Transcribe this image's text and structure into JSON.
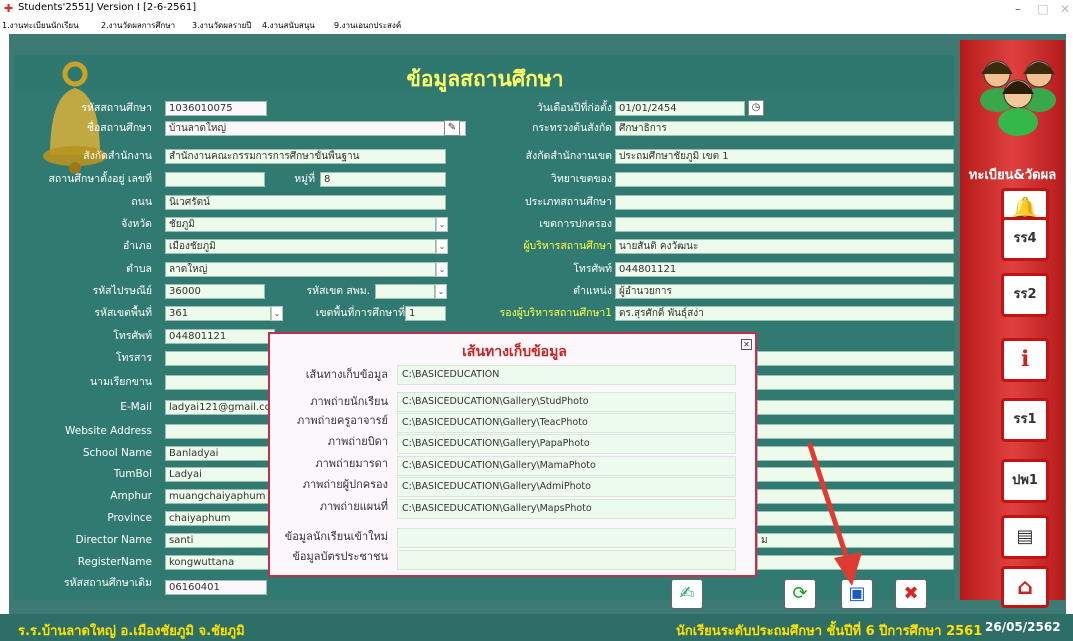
{
  "window": {
    "title": "Students'2551J Version I [2-6-2561]",
    "min": "–",
    "max": "□",
    "close": "✕"
  },
  "menu": [
    "1.งานทะเบียนนักเรียน",
    "2.งานวัดผลการศึกษา",
    "3.งานวัดผลรายปี",
    "4.งานสนับสนุน",
    "9.งานเอนกประสงค์"
  ],
  "page": {
    "title": "ข้อมูลสถานศึกษา"
  },
  "left": {
    "school_code": {
      "label": "รหัสสถานศึกษา",
      "value": "1036010075"
    },
    "school_name": {
      "label": "ชื่อสถานศึกษา",
      "value": "บ้านลาดใหญ่"
    },
    "agency": {
      "label": "สังกัดสำนักงาน",
      "value": "สำนักงานคณะกรรมการการศึกษาขั้นพื้นฐาน"
    },
    "address_no": {
      "label": "สถานศึกษาตั้งอยู่ เลขที่",
      "value": ""
    },
    "moo": {
      "label": "หมู่ที่",
      "value": "8"
    },
    "road": {
      "label": "ถนน",
      "value": "นิเวศรัตน์"
    },
    "province": {
      "label": "จังหวัด",
      "value": "ชัยภูมิ"
    },
    "district": {
      "label": "อำเภอ",
      "value": "เมืองชัยภูมิ"
    },
    "subdistrict": {
      "label": "ตำบล",
      "value": "ลาดใหญ่"
    },
    "postcode": {
      "label": "รหัสไปรษณีย์",
      "value": "36000"
    },
    "spm_code": {
      "label": "รหัสเขต สพม.",
      "value": ""
    },
    "area_code": {
      "label": "รหัสเขตพื้นที่",
      "value": "361"
    },
    "area_no": {
      "label": "เขตพื้นที่การศึกษาที่",
      "value": "1"
    },
    "phone": {
      "label": "โทรศัพท์",
      "value": "044801121"
    },
    "fax": {
      "label": "โทรสาร",
      "value": ""
    },
    "nickname": {
      "label": "นามเรียกขาน",
      "value": ""
    },
    "email": {
      "label": "E-Mail",
      "value": "ladyai121@gmail.com"
    },
    "website": {
      "label": "Website Address",
      "value": ""
    },
    "school_name_en": {
      "label": "School Name",
      "value": "Banladyai"
    },
    "tumbol": {
      "label": "TumBol",
      "value": "Ladyai"
    },
    "amphur": {
      "label": "Amphur",
      "value": "muangchaiyaphum"
    },
    "province_en": {
      "label": "Province",
      "value": "chaiyaphum"
    },
    "director_name": {
      "label": "Director Name",
      "value": "santi"
    },
    "register_name": {
      "label": "RegisterName",
      "value": "kongwuttana"
    },
    "old_code": {
      "label": "รหัสสถานศึกษาเดิม",
      "value": "06160401"
    }
  },
  "right": {
    "founded": {
      "label": "วันเดือนปีที่ก่อตั้ง",
      "value": "01/01/2454"
    },
    "ministry": {
      "label": "กระทรวงต้นสังกัด",
      "value": "ศึกษาธิการ"
    },
    "area_office": {
      "label": "สังกัดสำนักงานเขต",
      "value": "ประถมศึกษาชัยภูมิ เขต 1"
    },
    "college_zone": {
      "label": "วิทยาเขตของ",
      "value": ""
    },
    "school_type": {
      "label": "ประเภทสถานศึกษา",
      "value": ""
    },
    "admin_zone": {
      "label": "เขตการปกครอง",
      "value": ""
    },
    "director": {
      "label": "ผู้บริหารสถานศึกษา",
      "value": "นายสันติ คงวัฒนะ"
    },
    "phone": {
      "label": "โทรศัพท์",
      "value": "044801121"
    },
    "position": {
      "label": "ตำแหน่ง",
      "value": "ผู้อำนวยการ"
    },
    "deputy": {
      "label": "รองผู้บริหารสถานศึกษา1",
      "value": "ดร.สุรศักดิ์ พันธุ์สง่า"
    },
    "extra": "ม"
  },
  "modal": {
    "title": "เส้นทางเก็บข้อมูล",
    "rows": [
      {
        "label": "เส้นทางเก็บข้อมูล",
        "value": "C:\\BASICEDUCATION"
      },
      {
        "label": "ภาพถ่ายนักเรียน",
        "value": "C:\\BASICEDUCATION\\Gallery\\StudPhoto"
      },
      {
        "label": "ภาพถ่ายครูอาจารย์",
        "value": "C:\\BASICEDUCATION\\Gallery\\TeacPhoto"
      },
      {
        "label": "ภาพถ่ายบิดา",
        "value": "C:\\BASICEDUCATION\\Gallery\\PapaPhoto"
      },
      {
        "label": "ภาพถ่ายมารดา",
        "value": "C:\\BASICEDUCATION\\Gallery\\MamaPhoto"
      },
      {
        "label": "ภาพถ่ายผู้ปกครอง",
        "value": "C:\\BASICEDUCATION\\Gallery\\AdmiPhoto"
      },
      {
        "label": "ภาพถ่ายแผนที่",
        "value": "C:\\BASICEDUCATION\\Gallery\\MapsPhoto"
      }
    ],
    "extra_label1": "ข้อมูลนักเรียนเข้าใหม่",
    "extra_label2": "ข้อมูลบัตรประชาชน"
  },
  "sidebar": {
    "label": "ทะเบียน&วัดผล",
    "buttons": [
      "รร4",
      "รร2",
      "รร1",
      "ปพ1"
    ]
  },
  "footer": {
    "left": "ร.ร.บ้านลาดใหญ่ อ.เมืองชัยภูมิ จ.ชัยภูมิ",
    "right": "นักเรียนระดับประถมศึกษา ชั้นปีที่ 6 ปีการศึกษา 2561",
    "date": "26/05/2562"
  },
  "colors": {
    "main_bg": "#307a72",
    "title": "#ffff66",
    "sidebar": "#c41111",
    "modal_border": "#c4304c"
  }
}
